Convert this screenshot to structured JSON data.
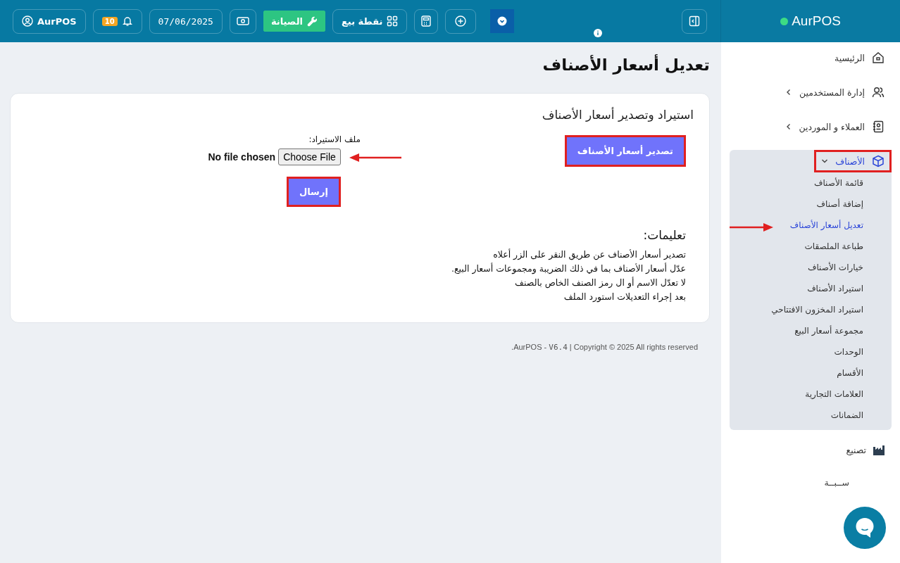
{
  "brand": {
    "name": "AurPOS",
    "online": true
  },
  "topbar": {
    "user": "AurPOS",
    "notifications": "10",
    "date": "07/06/2025",
    "maintenance": "الصيانة",
    "pos": "نقطة بيع"
  },
  "sidebar": {
    "items": [
      {
        "label": "الرئيسية",
        "kind": "home",
        "expandable": false,
        "expanded": false,
        "selected": false,
        "highlighted": false
      },
      {
        "label": "إدارة المستخدمين",
        "kind": "users",
        "expandable": true,
        "expanded": false,
        "selected": false,
        "highlighted": false
      },
      {
        "label": "العملاء و الموردين",
        "kind": "contacts",
        "expandable": true,
        "expanded": false,
        "selected": false,
        "highlighted": false
      },
      {
        "label": "الأصناف",
        "kind": "box",
        "expandable": true,
        "expanded": true,
        "selected": true,
        "highlighted": true,
        "children": [
          {
            "label": "قائمة الأصناف",
            "selected": false,
            "arrow": false
          },
          {
            "label": "إضافة أصناف",
            "selected": false,
            "arrow": false
          },
          {
            "label": "تعديل أسعار الأصناف",
            "selected": true,
            "arrow": true
          },
          {
            "label": "طباعة الملصقات",
            "selected": false,
            "arrow": false
          },
          {
            "label": "خيارات الأصناف",
            "selected": false,
            "arrow": false
          },
          {
            "label": "استيراد الأصناف",
            "selected": false,
            "arrow": false
          },
          {
            "label": "استيراد المخزون الافتتاحي",
            "selected": false,
            "arrow": false
          },
          {
            "label": "مجموعة أسعار البيع",
            "selected": false,
            "arrow": false
          },
          {
            "label": "الوحدات",
            "selected": false,
            "arrow": false
          },
          {
            "label": "الأقسام",
            "selected": false,
            "arrow": false
          },
          {
            "label": "العلامات التجارية",
            "selected": false,
            "arrow": false
          },
          {
            "label": "الضمانات",
            "selected": false,
            "arrow": false
          }
        ]
      },
      {
        "label": "تصنيع",
        "kind": "factory",
        "expandable": false,
        "expanded": false,
        "selected": false,
        "highlighted": false
      },
      {
        "label": "ســبــة",
        "kind": "none",
        "expandable": false,
        "expanded": false,
        "selected": false,
        "highlighted": false
      }
    ]
  },
  "page": {
    "title": "تعديل أسعار الأصناف",
    "card": {
      "heading": "استيراد وتصدير أسعار الأصناف",
      "export_button": {
        "label": "تصدير أسعار الأصناف",
        "highlighted": true
      },
      "file_label": "ملف الاستيراد:",
      "file_input": {
        "button": "Choose File",
        "status": "No file chosen",
        "arrow": true
      },
      "submit_button": {
        "label": "إرسال",
        "highlighted": true
      },
      "instructions_heading": "تعليمات:",
      "instructions": [
        "تصدير أسعار الأصناف عن طريق النقر على الزر أعلاه",
        "عدّل أسعار الأصناف بما في ذلك الضريبة ومجموعات أسعار البيع.",
        "لا تعدّل الاسم أو ال رمز الصنف الخاص بالصنف",
        "بعد إجراء التعديلات استورد الملف"
      ]
    },
    "footer": {
      "before": ".AurPOS - ",
      "version": "V6.4",
      "after": " | Copyright © 2025 All rights reserved"
    }
  }
}
